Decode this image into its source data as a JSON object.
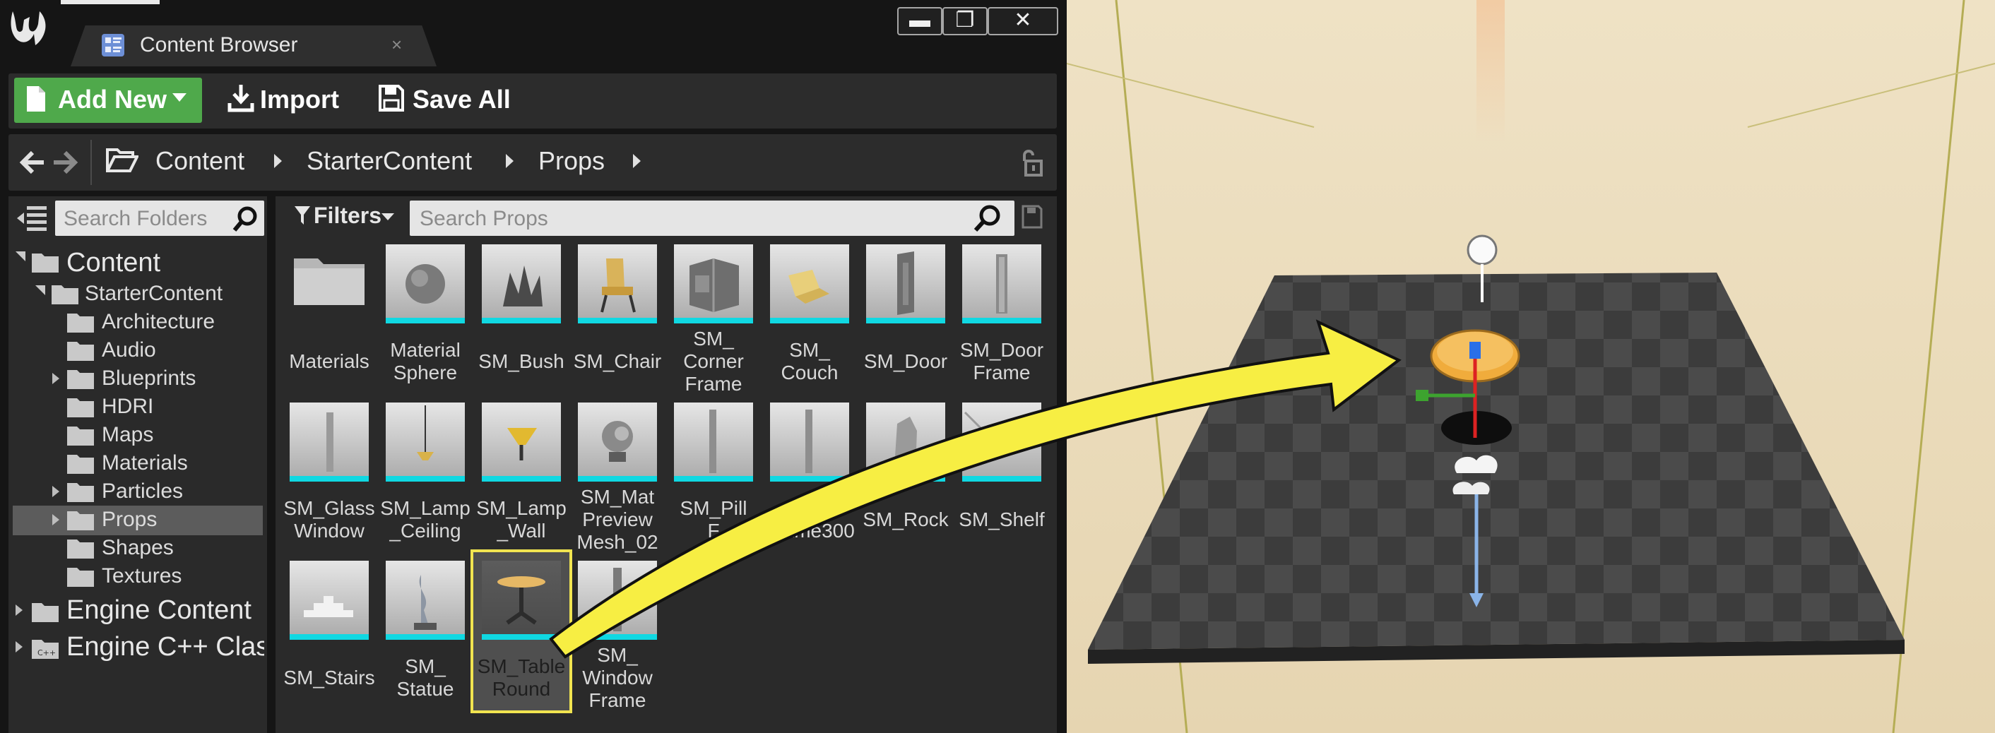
{
  "window": {
    "tab_title": "Content Browser",
    "tab_close": "×",
    "tab_icon": "content-browser-icon",
    "buttons": {
      "minimize": "▬",
      "maximize": "❐",
      "close": "✕"
    },
    "logo": "unreal-engine-logo-icon"
  },
  "toolbar": {
    "add_new_label": "Add New",
    "import_label": "Import",
    "save_all_label": "Save All",
    "add_new_color": "#4fa94b"
  },
  "path": {
    "crumbs": [
      "Content",
      "StarterContent",
      "Props"
    ]
  },
  "folders": {
    "search_placeholder": "Search Folders",
    "tree": {
      "content": "Content",
      "starter_content": "StarterContent",
      "architecture": "Architecture",
      "audio": "Audio",
      "blueprints": "Blueprints",
      "hdri": "HDRI",
      "maps": "Maps",
      "materials": "Materials",
      "particles": "Particles",
      "props": "Props",
      "shapes": "Shapes",
      "textures": "Textures",
      "engine_content": "Engine Content",
      "engine_cpp": "Engine C++ Clas"
    },
    "selected": "Props"
  },
  "assets": {
    "filters_label": "Filters",
    "search_placeholder": "Search Props",
    "items": [
      {
        "name": "Materials"
      },
      {
        "name": "Material\nSphere"
      },
      {
        "name": "SM_Bush"
      },
      {
        "name": "SM_Chair"
      },
      {
        "name": "SM_\nCorner\nFrame"
      },
      {
        "name": "SM_\nCouch"
      },
      {
        "name": "SM_Door"
      },
      {
        "name": "SM_Door\nFrame"
      },
      {
        "name": "SM_Glass\nWindow"
      },
      {
        "name": "SM_Lamp\n_Ceiling"
      },
      {
        "name": "SM_Lamp\n_Wall"
      },
      {
        "name": "SM_Mat\nPreview\nMesh_02"
      },
      {
        "name": "SM_Pill\nF"
      },
      {
        "name": "_Pillar\nFrame300"
      },
      {
        "name": "SM_Rock"
      },
      {
        "name": "SM_Shelf"
      },
      {
        "name": "SM_Stairs"
      },
      {
        "name": "SM_\nStatue"
      },
      {
        "name": "SM_Table\nRound"
      },
      {
        "name": "SM_\nWindow\nFrame"
      }
    ],
    "selected": "SM_Table Round",
    "selection_color": "#f1e450",
    "accent_bar_color": "#10d8e2"
  },
  "annotation": {
    "arrow_color": "#f7ee43"
  }
}
